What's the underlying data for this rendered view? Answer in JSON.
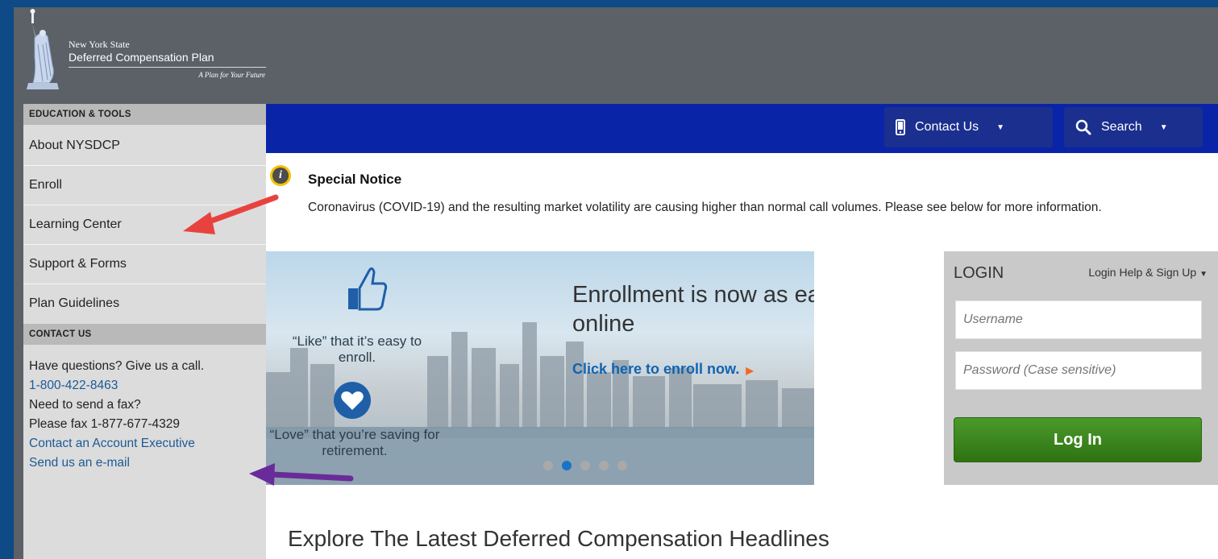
{
  "header": {
    "logo_state": "New York State",
    "logo_plan": "Deferred Compensation Plan",
    "logo_tagline": "A Plan for Your Future"
  },
  "sidebar": {
    "education_heading": "EDUCATION & TOOLS",
    "items": [
      {
        "label": "About NYSDCP"
      },
      {
        "label": "Enroll"
      },
      {
        "label": "Learning Center"
      },
      {
        "label": "Support & Forms"
      },
      {
        "label": "Plan Guidelines"
      }
    ],
    "contact_heading": "CONTACT US",
    "contact": {
      "questions": "Have questions? Give us a call.",
      "phone": "1-800-422-8463",
      "fax_question": "Need to send a fax?",
      "fax": "Please fax 1-877-677-4329",
      "account_exec": "Contact an Account Executive",
      "email": "Send us an e-mail"
    }
  },
  "topnav": {
    "contact_label": "Contact Us",
    "search_label": "Search"
  },
  "notice": {
    "title": "Special Notice",
    "body": "Coronavirus (COVID-19) and the resulting market volatility are causing higher than normal call volumes. Please see below for more information."
  },
  "hero": {
    "like_text": "“Like” that it’s easy to enroll.",
    "love_text": "“Love” that you’re saving for retirement.",
    "headline": "Enrollment is now as easy as going online",
    "cta": "Click here to enroll now.",
    "slides_total": 5,
    "active_slide": 2
  },
  "login": {
    "title": "LOGIN",
    "help": "Login Help & Sign Up",
    "username_placeholder": "Username",
    "password_placeholder": "Password (Case sensitive)",
    "button": "Log In"
  },
  "headlines_title": "Explore The Latest Deferred Compensation Headlines",
  "colors": {
    "nav_bar": "#0a24a8",
    "login_button": "#3a8a1d",
    "link": "#1c5a96",
    "annotation_red": "#e8423f",
    "annotation_purple": "#6a2b9a"
  }
}
